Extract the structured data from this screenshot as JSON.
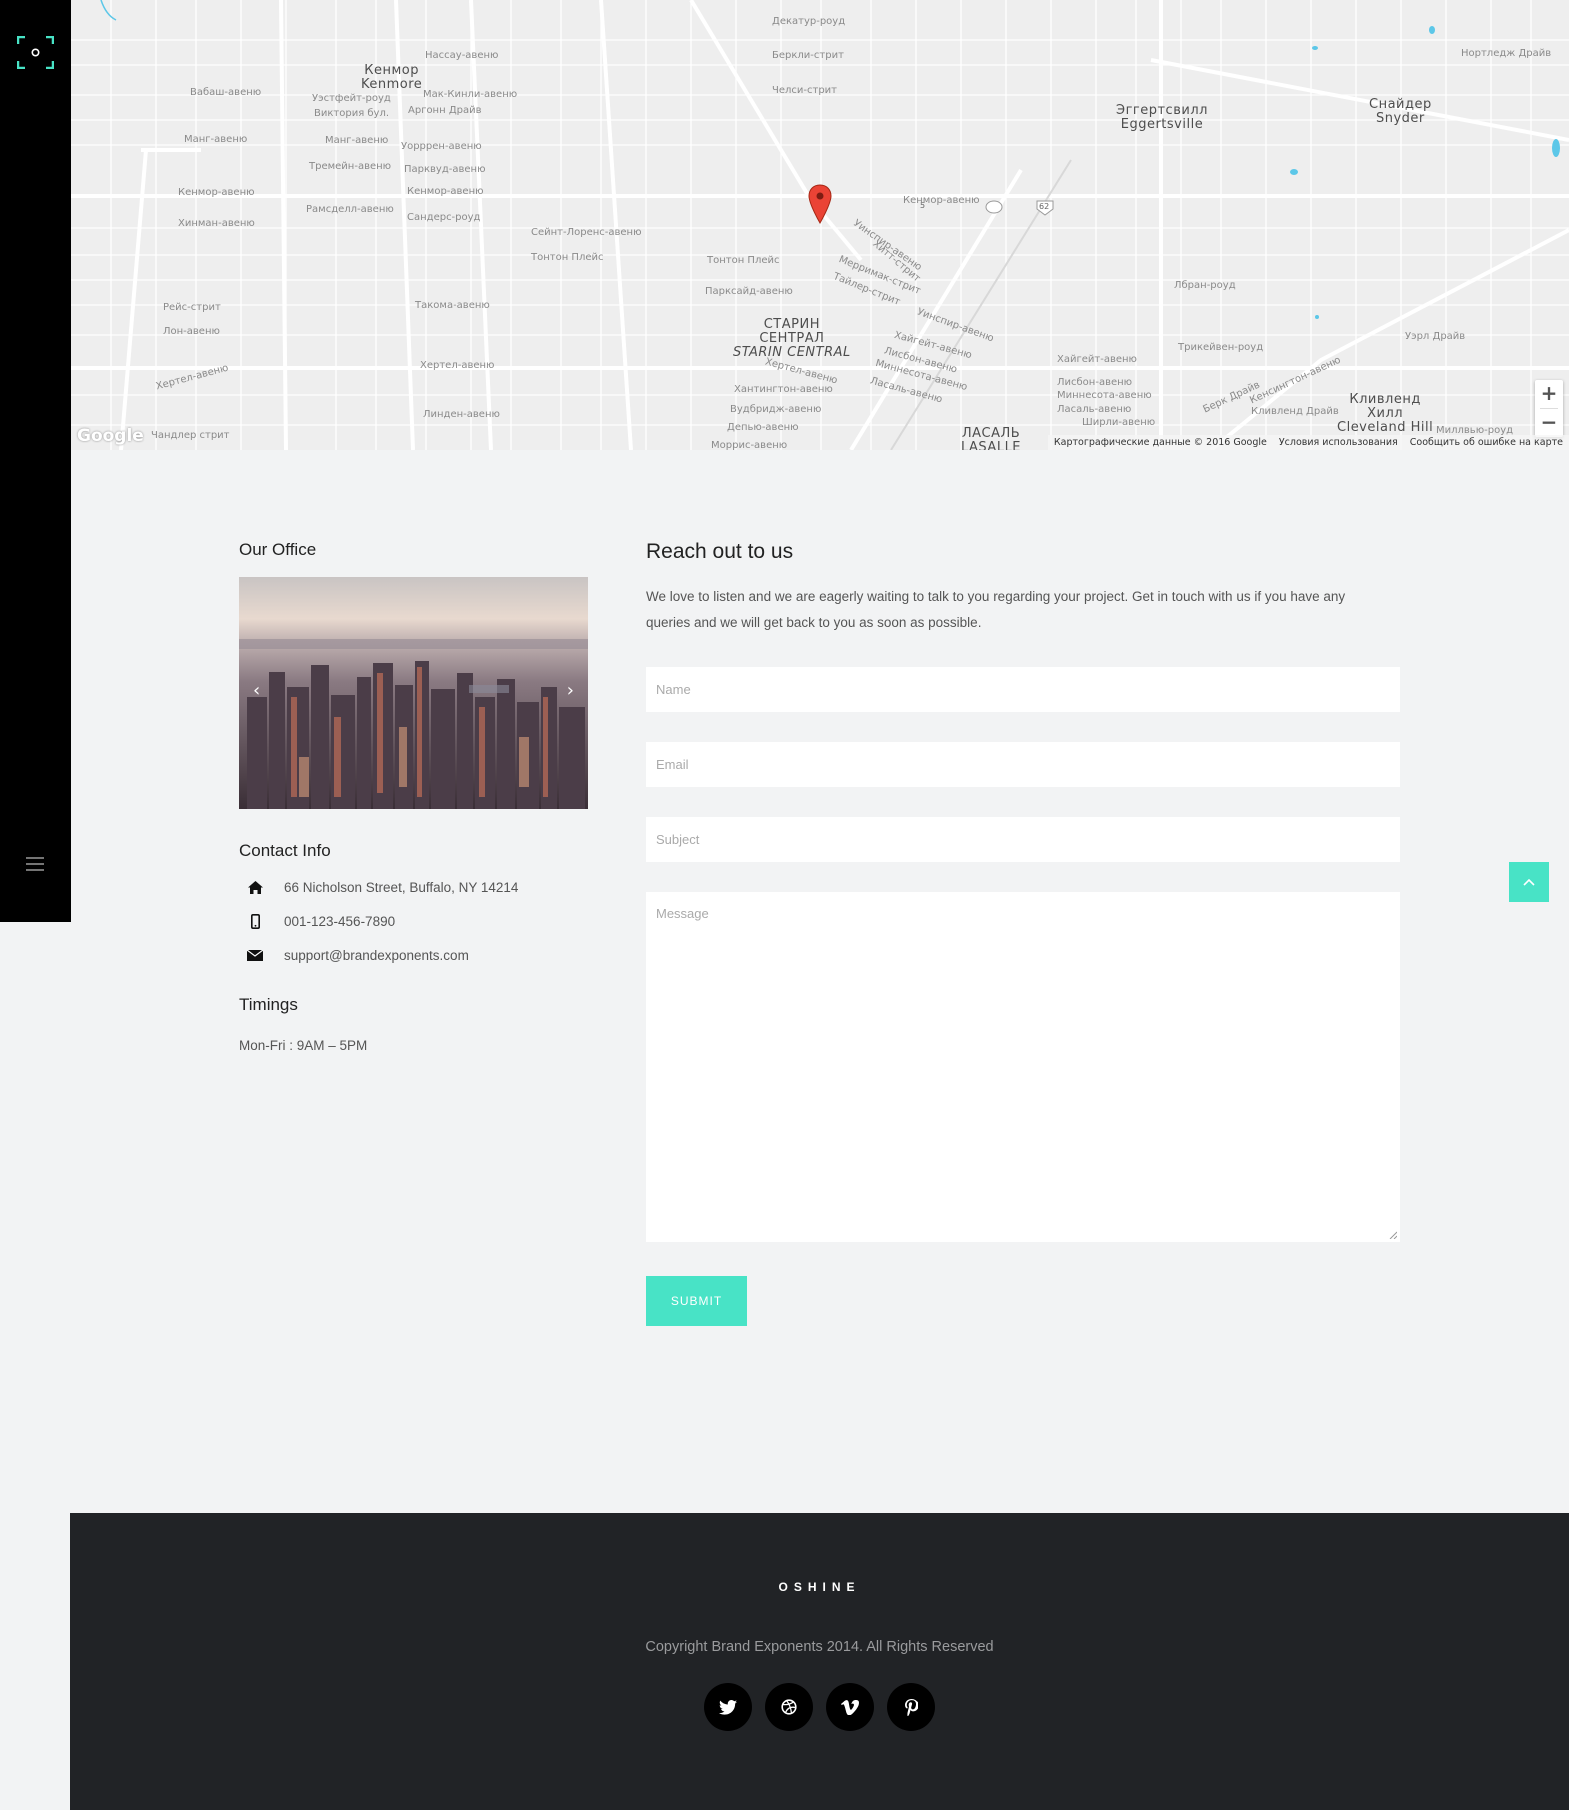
{
  "sidebar": {
    "logo_icon": "focus-frame-icon",
    "menu_icon": "hamburger-icon",
    "accent": "#48e3c6"
  },
  "map": {
    "labels": {
      "kenmore": "Кенмор",
      "kenmore_en": "Kenmore",
      "eggertsville": "Эггертсвилл",
      "eggertsville_en": "Eggertsville",
      "snyder": "Снайдер",
      "snyder_en": "Snyder",
      "starin_1": "СТАРИН",
      "starin_2": "СЕНТРАЛ",
      "starin_en": "STARIN CENTRAL",
      "cleveland_1": "Кливленд",
      "cleveland_2": "Хилл",
      "cleveland_en": "Cleveland Hill",
      "lasalle": "ЛАСАЛЬ",
      "lasalle_en": "LASALLE",
      "kenmore_ave": "Кенмор-авеню",
      "kenmore_ave_2": "Кенмор-авеню",
      "kenmore_ave_3": "Кенмор-авеню",
      "nassau": "Нассау-авеню",
      "wabash": "Вабаш-авеню",
      "mang": "Манг-авеню",
      "mang_2": "Манг-авеню",
      "hinman": "Хинман-авеню",
      "ramsdell": "Рамсделл-авеню",
      "sanders": "Сандерс-роуд",
      "saint_lawrence": "Сейнт-Лоренс-авеню",
      "taunton": "Тонтон Плейс",
      "taunton_2": "Тонтон Плейс",
      "parkside": "Парксайд-авеню",
      "takoma": "Такома-авеню",
      "hertel": "Хертел-авеню",
      "hertel_2": "Хертел-авеню",
      "hertel_3": "Хертел-авеню",
      "linden": "Линден-авеню",
      "chandler": "Чандлер стрит",
      "rice": "Рейс-стрит",
      "lawn": "Лон-авеню",
      "decatur": "Декатур-роуд",
      "berkeley": "Беркли-стрит",
      "chelsea": "Челси-стрит",
      "warren": "Уорррен-авеню",
      "parkwood": "Парквуд-авеню",
      "tremaine": "Тремейн-авеню",
      "mckinley": "Мак-Кинли-авеню",
      "argonne": "Аргонн Драйв",
      "westfield": "Уэстфейт-роуд",
      "victoria": "Виктория бул.",
      "huntington": "Хантингтон-авеню",
      "woodbridge": "Вудбридж-авеню",
      "delaware": "Депью-авеню",
      "morris": "Моррис-авеню",
      "nortledge": "Нортледж Драйв",
      "ural": "Уэрл Драйв",
      "leblanc": "Лбран-роуд",
      "trykeyven": "Трикейвен-роуд",
      "highgate": "Хайгейт-авеню",
      "lisbon": "Лисбон-авеню",
      "minnesota": "Миннесота-авеню",
      "lasalle_ave": "Ласаль-авеню",
      "shirley": "Ширли-авеню",
      "berk": "Берк Драйв",
      "kensington": "Кенсингтон-авеню",
      "winspear": "Уинспир-авеню",
      "highgate_2": "Хайгейт-авеню",
      "lisbon_2": "Лисбон-авеню",
      "minnesota_2": "Миннесота-авеню",
      "lasalle_ave_2": "Ласаль-авеню",
      "merrimac": "Мерримак-стрит",
      "tyler": "Тайлер-стрит",
      "hitt": "Хитт-стрит",
      "winspear_2": "Уинспир-авеню",
      "cleveland_dr": "Кливленд Драйв",
      "millview": "Миллвью-роуд",
      "route_5": "5",
      "route_62": "62"
    },
    "pin_icon": "map-pin-icon",
    "zoom_in": "+",
    "zoom_out": "−",
    "google": "Google",
    "attribution": "Картографические данные © 2016 Google",
    "terms": "Условия использования",
    "report": "Сообщить об ошибке на карте"
  },
  "office": {
    "title": "Our Office",
    "prev_arrow": "‹",
    "next_arrow": "›"
  },
  "contact_info": {
    "title": "Contact Info",
    "address": "66 Nicholson Street, Buffalo, NY 14214",
    "phone": "001-123-456-7890",
    "email": "support@brandexponents.com"
  },
  "timings": {
    "title": "Timings",
    "hours": "Mon-Fri : 9AM – 5PM"
  },
  "form": {
    "title": "Reach out to us",
    "intro": "We love to listen and we are eagerly waiting to talk to you regarding your project. Get in touch with us if you have any queries and we will get back to you as soon as possible.",
    "name_placeholder": "Name",
    "email_placeholder": "Email",
    "subject_placeholder": "Subject",
    "message_placeholder": "Message",
    "submit_label": "SUBMIT"
  },
  "back_to_top_icon": "chevron-up-icon",
  "footer": {
    "brand": "OSHINE",
    "copyright": "Copyright Brand Exponents 2014. All Rights Reserved",
    "socials": [
      "twitter-icon",
      "dribbble-icon",
      "vimeo-icon",
      "pinterest-icon"
    ]
  }
}
